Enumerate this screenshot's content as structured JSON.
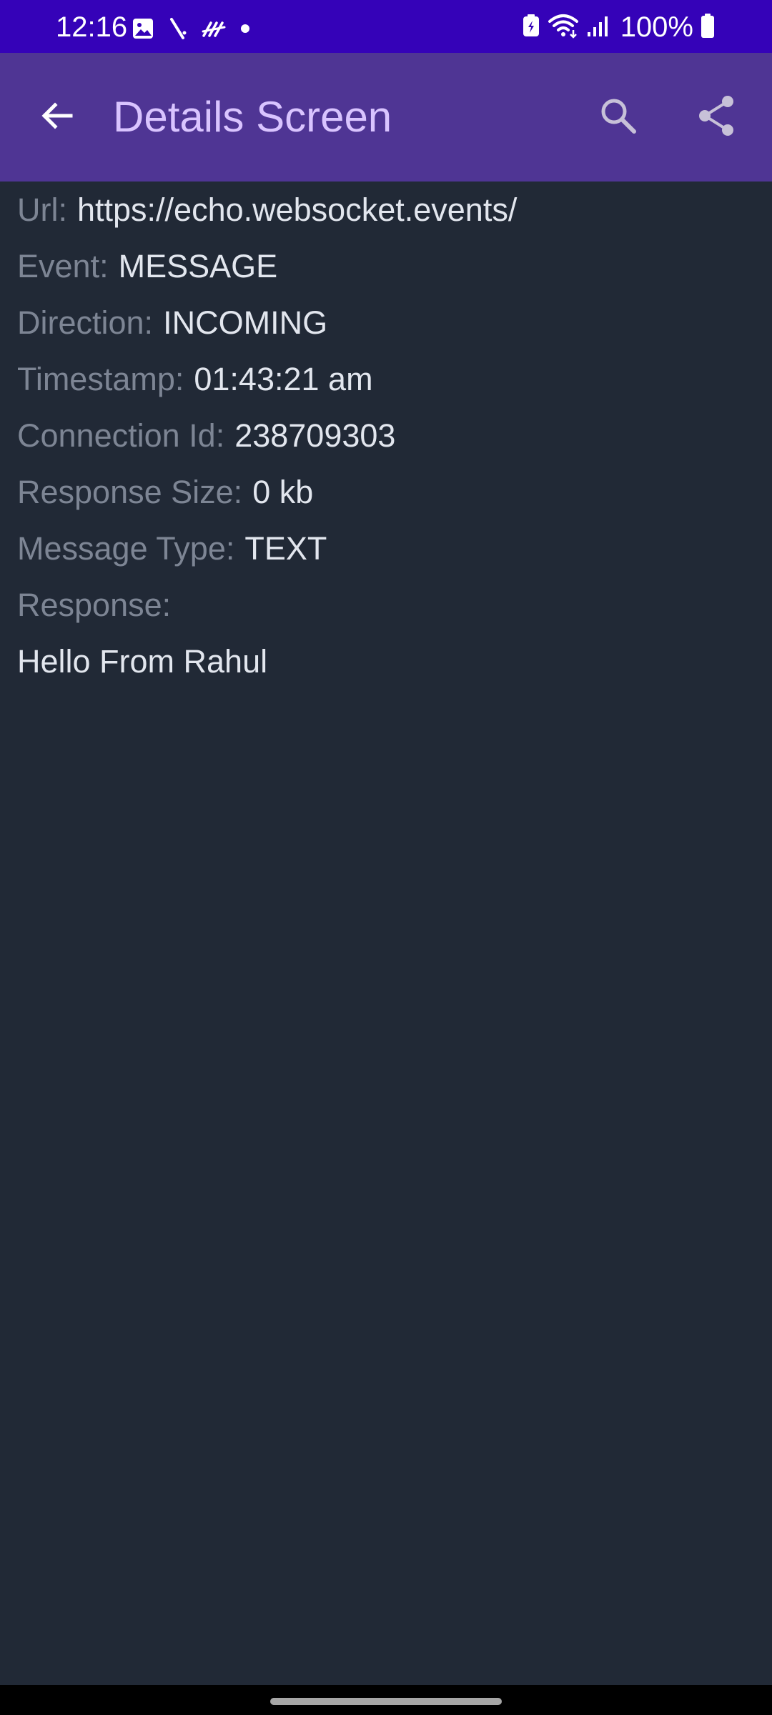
{
  "status_bar": {
    "time": "12:16",
    "battery": "100%",
    "icons": [
      "gallery-icon",
      "slash-icon",
      "hatch-icon",
      "dot-icon",
      "battery-saver-icon",
      "wifi-icon",
      "signal-icon",
      "battery-icon"
    ]
  },
  "app_bar": {
    "title": "Details Screen",
    "back_icon": "arrow-back-icon",
    "search_icon": "search-icon",
    "share_icon": "share-icon"
  },
  "details": {
    "url_label": "Url:",
    "url_value": "https://echo.websocket.events/",
    "event_label": "Event:",
    "event_value": "MESSAGE",
    "direction_label": "Direction:",
    "direction_value": "INCOMING",
    "timestamp_label": "Timestamp:",
    "timestamp_value": "01:43:21 am",
    "connection_label": "Connection Id:",
    "connection_value": "238709303",
    "size_label": "Response Size:",
    "size_value": "0 kb",
    "type_label": "Message Type:",
    "type_value": "TEXT",
    "response_label": "Response:",
    "response_body": "Hello From Rahul"
  },
  "colors": {
    "status_bar": "#3502b8",
    "app_bar": "#4f3594",
    "title": "#d9c4ff",
    "background": "#212936",
    "label": "#7d8594",
    "value": "#e2e6ee"
  }
}
